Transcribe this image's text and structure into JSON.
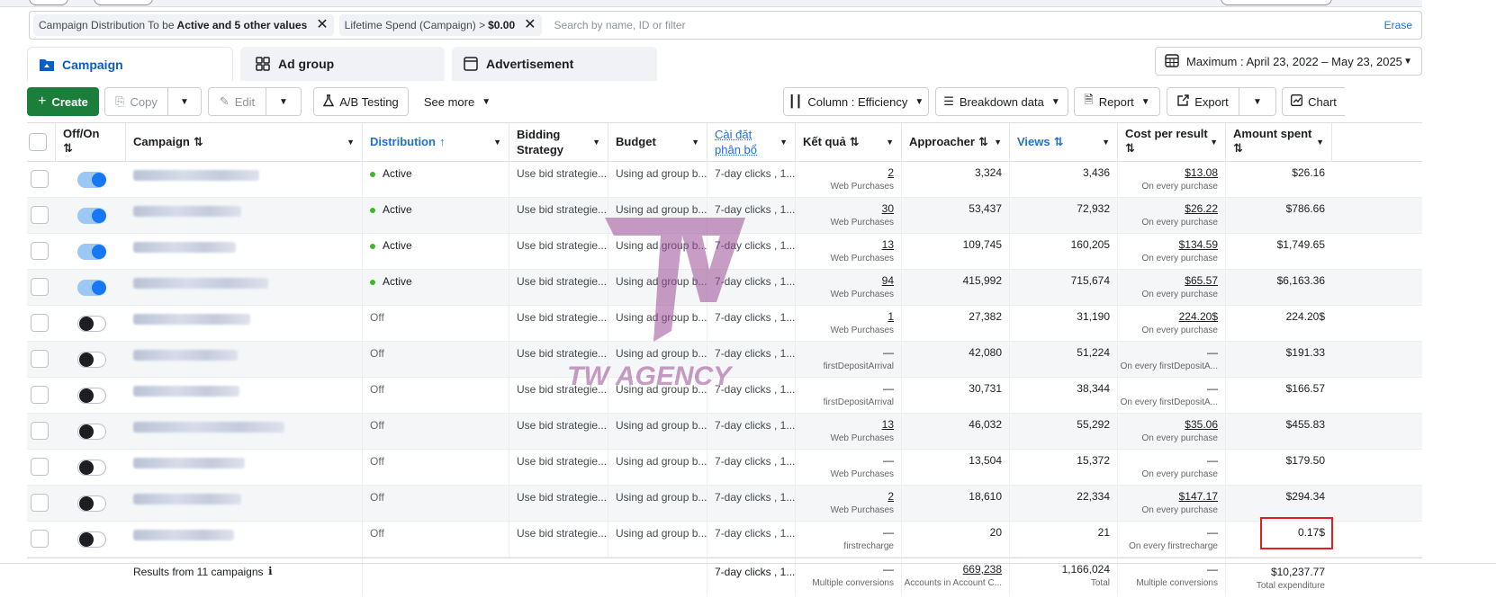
{
  "filters": {
    "chip1_prefix": "Campaign Distribution To be",
    "chip1_bold": "Active and 5 other values",
    "chip2_prefix": "Lifetime Spend (Campaign) >",
    "chip2_bold": "$0.00",
    "search_placeholder": "Search by name, ID or filter",
    "erase_label": "Erase"
  },
  "tabs": [
    {
      "label": "Campaign",
      "icon": "folder-icon",
      "active": true
    },
    {
      "label": "Ad group",
      "icon": "grid-icon",
      "active": false
    },
    {
      "label": "Advertisement",
      "icon": "ad-window-icon",
      "active": false
    }
  ],
  "date_range": "Maximum : April 23, 2022 – May 23, 2025",
  "toolbar": {
    "create": "Create",
    "copy": "Copy",
    "edit": "Edit",
    "ab_testing": "A/B Testing",
    "see_more": "See more",
    "column": "Column : Efficiency",
    "breakdown": "Breakdown data",
    "report": "Report",
    "export": "Export",
    "chart": "Chart"
  },
  "columns": {
    "offon": "Off/On",
    "campaign": "Campaign",
    "distribution": "Distribution",
    "bidding": "Bidding Strategy",
    "budget": "Budget",
    "attribution": "Cài đặt phân bổ",
    "results": "Kết quả",
    "reach": "Approacher",
    "views": "Views",
    "cpr": "Cost per result",
    "spent": "Amount spent"
  },
  "rows": [
    {
      "on": true,
      "status": "Active",
      "bid": "Use bid strategie...",
      "budget": "Using ad group b...",
      "attr": "7-day clicks , 1...",
      "result": "2",
      "result_type": "Web Purchases",
      "reach": "3,324",
      "views": "3,436",
      "cpr": "$13.08",
      "cpr_type": "On every purchase",
      "spent": "$26.16"
    },
    {
      "on": true,
      "status": "Active",
      "bid": "Use bid strategie...",
      "budget": "Using ad group b...",
      "attr": "7-day clicks , 1...",
      "result": "30",
      "result_type": "Web Purchases",
      "reach": "53,437",
      "views": "72,932",
      "cpr": "$26.22",
      "cpr_type": "On every purchase",
      "spent": "$786.66"
    },
    {
      "on": true,
      "status": "Active",
      "bid": "Use bid strategie...",
      "budget": "Using ad group b...",
      "attr": "7-day clicks , 1...",
      "result": "13",
      "result_type": "Web Purchases",
      "reach": "109,745",
      "views": "160,205",
      "cpr": "$134.59",
      "cpr_type": "On every purchase",
      "spent": "$1,749.65"
    },
    {
      "on": true,
      "status": "Active",
      "bid": "Use bid strategie...",
      "budget": "Using ad group b...",
      "attr": "7-day clicks , 1...",
      "result": "94",
      "result_type": "Web Purchases",
      "reach": "415,992",
      "views": "715,674",
      "cpr": "$65.57",
      "cpr_type": "On every purchase",
      "spent": "$6,163.36"
    },
    {
      "on": false,
      "status": "Off",
      "bid": "Use bid strategie...",
      "budget": "Using ad group b...",
      "attr": "7-day clicks , 1...",
      "result": "1",
      "result_type": "Web Purchases",
      "reach": "27,382",
      "views": "31,190",
      "cpr": "224.20$",
      "cpr_type": "On every purchase",
      "spent": "224.20$"
    },
    {
      "on": false,
      "status": "Off",
      "bid": "Use bid strategie...",
      "budget": "Using ad group b...",
      "attr": "7-day clicks , 1...",
      "result": "—",
      "result_type": "firstDepositArrival",
      "reach": "42,080",
      "views": "51,224",
      "cpr": "—",
      "cpr_type": "On every firstDepositA...",
      "spent": "$191.33"
    },
    {
      "on": false,
      "status": "Off",
      "bid": "Use bid strategie...",
      "budget": "Using ad group b...",
      "attr": "7-day clicks , 1...",
      "result": "—",
      "result_type": "firstDepositArrival",
      "reach": "30,731",
      "views": "38,344",
      "cpr": "—",
      "cpr_type": "On every firstDepositA...",
      "spent": "$166.57"
    },
    {
      "on": false,
      "status": "Off",
      "bid": "Use bid strategie...",
      "budget": "Using ad group b...",
      "attr": "7-day clicks , 1...",
      "result": "13",
      "result_type": "Web Purchases",
      "reach": "46,032",
      "views": "55,292",
      "cpr": "$35.06",
      "cpr_type": "On every purchase",
      "spent": "$455.83"
    },
    {
      "on": false,
      "status": "Off",
      "bid": "Use bid strategie...",
      "budget": "Using ad group b...",
      "attr": "7-day clicks , 1...",
      "result": "—",
      "result_type": "Web Purchases",
      "reach": "13,504",
      "views": "15,372",
      "cpr": "—",
      "cpr_type": "On every purchase",
      "spent": "$179.50"
    },
    {
      "on": false,
      "status": "Off",
      "bid": "Use bid strategie...",
      "budget": "Using ad group b...",
      "attr": "7-day clicks , 1...",
      "result": "2",
      "result_type": "Web Purchases",
      "reach": "18,610",
      "views": "22,334",
      "cpr": "$147.17",
      "cpr_type": "On every purchase",
      "spent": "$294.34"
    },
    {
      "on": false,
      "status": "Off",
      "bid": "Use bid strategie...",
      "budget": "Using ad group b...",
      "attr": "7-day clicks , 1...",
      "result": "—",
      "result_type": "firstrecharge",
      "reach": "20",
      "views": "21",
      "cpr": "—",
      "cpr_type": "On every firstrecharge",
      "spent": "0.17$"
    }
  ],
  "footer": {
    "label": "Results from 11 campaigns",
    "attr": "7-day clicks , 1...",
    "result": "—",
    "result_type": "Multiple conversions",
    "reach": "669,238",
    "reach_type": "Accounts in Account C...",
    "views": "1,166,024",
    "views_type": "Total",
    "cpr": "—",
    "cpr_type": "Multiple conversions",
    "spent": "$10,237.77",
    "spent_type": "Total expenditure"
  },
  "watermark": "TW AGENCY",
  "colors": {
    "accent": "#216fdb",
    "create_green": "#1b7f3b",
    "active_dot": "#42b72a",
    "highlight": "#e02020"
  }
}
